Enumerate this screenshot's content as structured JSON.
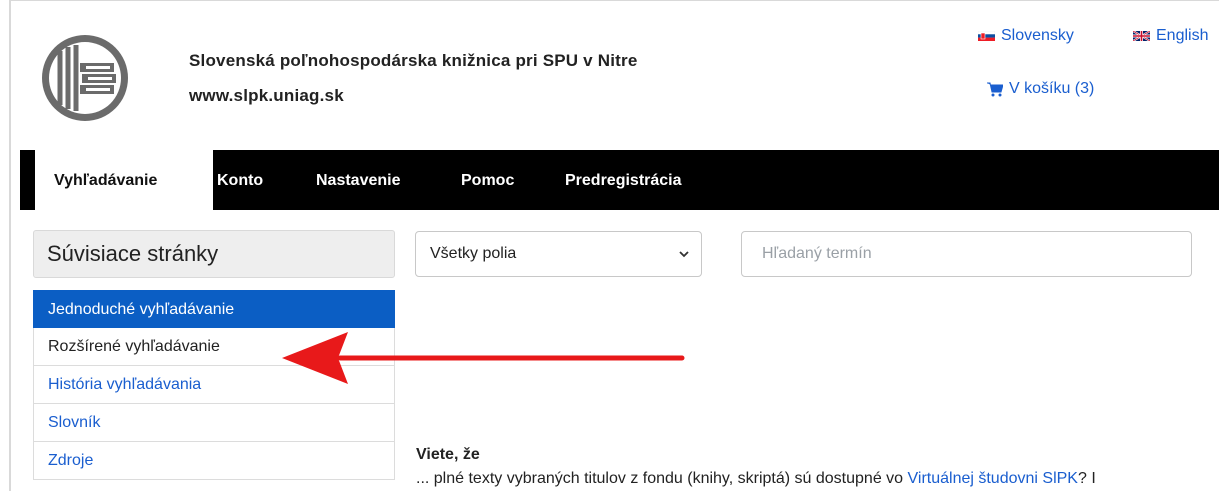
{
  "header": {
    "library_name": "Slovenská poľnohospodárska knižnica pri SPU v Nitre",
    "library_url": "www.slpk.uniag.sk",
    "logo_icon": "slpk-logo-icon"
  },
  "top_links": {
    "lang_sk": "Slovensky",
    "lang_en": "English",
    "cart": "V košíku (3)"
  },
  "nav": {
    "tabs": [
      {
        "label": "Vyhľadávanie",
        "active": true
      },
      {
        "label": "Konto"
      },
      {
        "label": "Nastavenie"
      },
      {
        "label": "Pomoc"
      },
      {
        "label": "Predregistrácia"
      }
    ]
  },
  "sidebar": {
    "title": "Súvisiace stránky",
    "items": [
      {
        "label": "Jednoduché vyhľadávanie",
        "active": true
      },
      {
        "label": "Rozšírené vyhľadávanie"
      },
      {
        "label": "História vyhľadávania"
      },
      {
        "label": "Slovník"
      },
      {
        "label": "Zdroje"
      }
    ]
  },
  "search": {
    "field_selected": "Všetky polia",
    "placeholder": "Hľadaný termín"
  },
  "did_you_know": {
    "title": "Viete, že",
    "text_before": "... plné texty vybraných titulov z fondu (knihy, skriptá) sú dostupné vo ",
    "link": "Virtuálnej študovni SlPK",
    "text_after": "? I"
  },
  "colors": {
    "accent_blue": "#0b5ec4",
    "link_blue": "#1a5ecf",
    "nav_bg": "#000000",
    "arrow_red": "#e8191a"
  }
}
